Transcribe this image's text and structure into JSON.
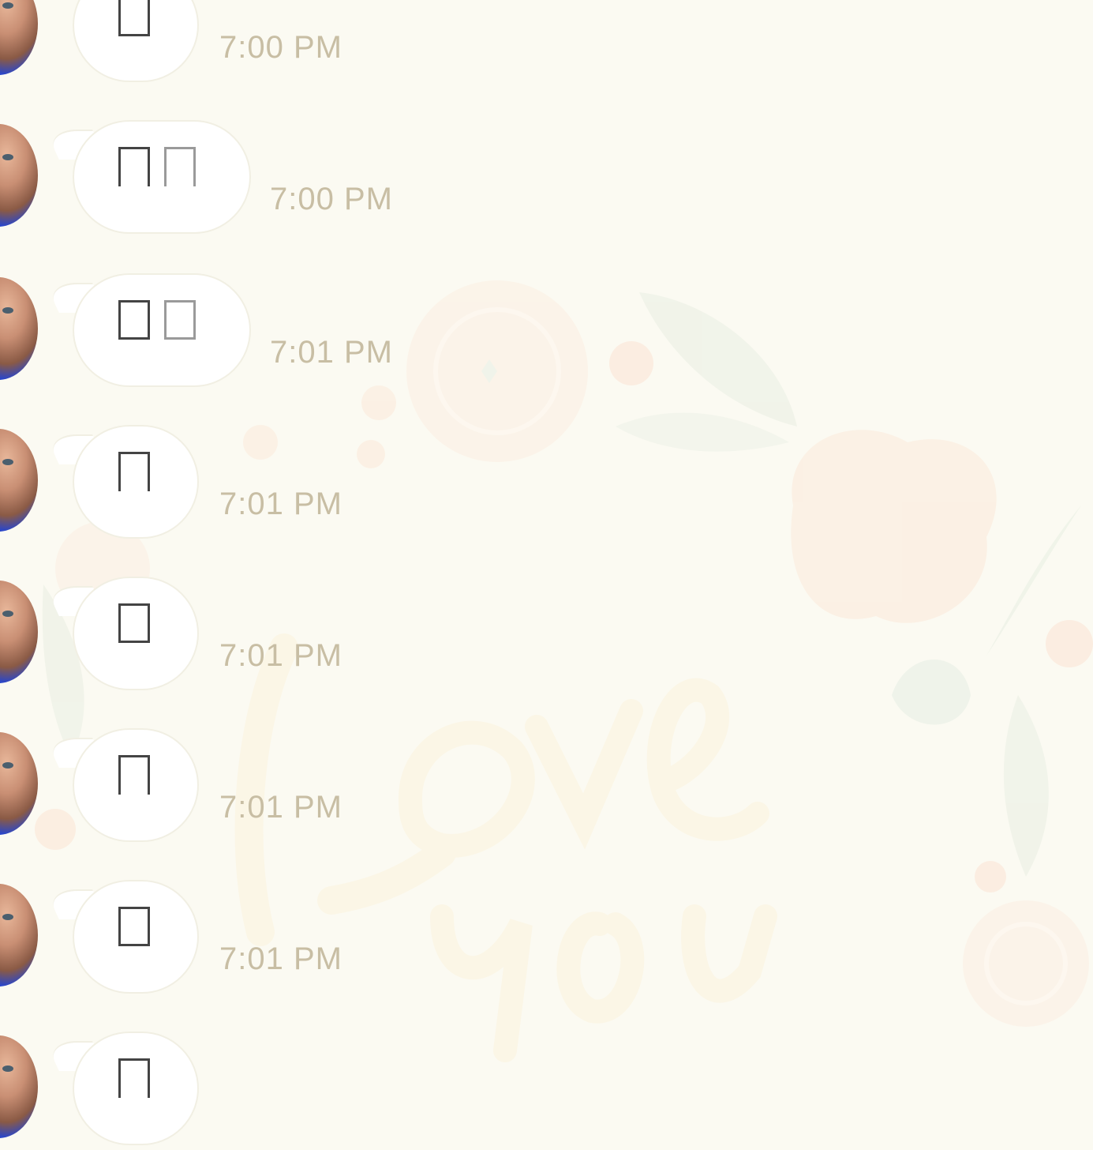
{
  "messages": [
    {
      "text": "",
      "glyphs": [
        "closed"
      ],
      "time": "7:00 PM"
    },
    {
      "text": "",
      "glyphs": [
        "open",
        "open-light"
      ],
      "time": "7:00 PM"
    },
    {
      "text": "",
      "glyphs": [
        "closed",
        "closed-light"
      ],
      "time": "7:01 PM"
    },
    {
      "text": "",
      "glyphs": [
        "open"
      ],
      "time": "7:01 PM"
    },
    {
      "text": "",
      "glyphs": [
        "closed"
      ],
      "time": "7:01 PM"
    },
    {
      "text": "",
      "glyphs": [
        "open"
      ],
      "time": "7:01 PM"
    },
    {
      "text": "",
      "glyphs": [
        "closed"
      ],
      "time": "7:01 PM"
    },
    {
      "text": "",
      "glyphs": [
        "open"
      ],
      "time": ""
    }
  ],
  "wallpaper": {
    "lettering": "Love you"
  },
  "colors": {
    "background": "#fbfaf2",
    "bubble": "#ffffff",
    "timestamp": "#c8bea4",
    "avatar_accent": "#1e36b8"
  }
}
